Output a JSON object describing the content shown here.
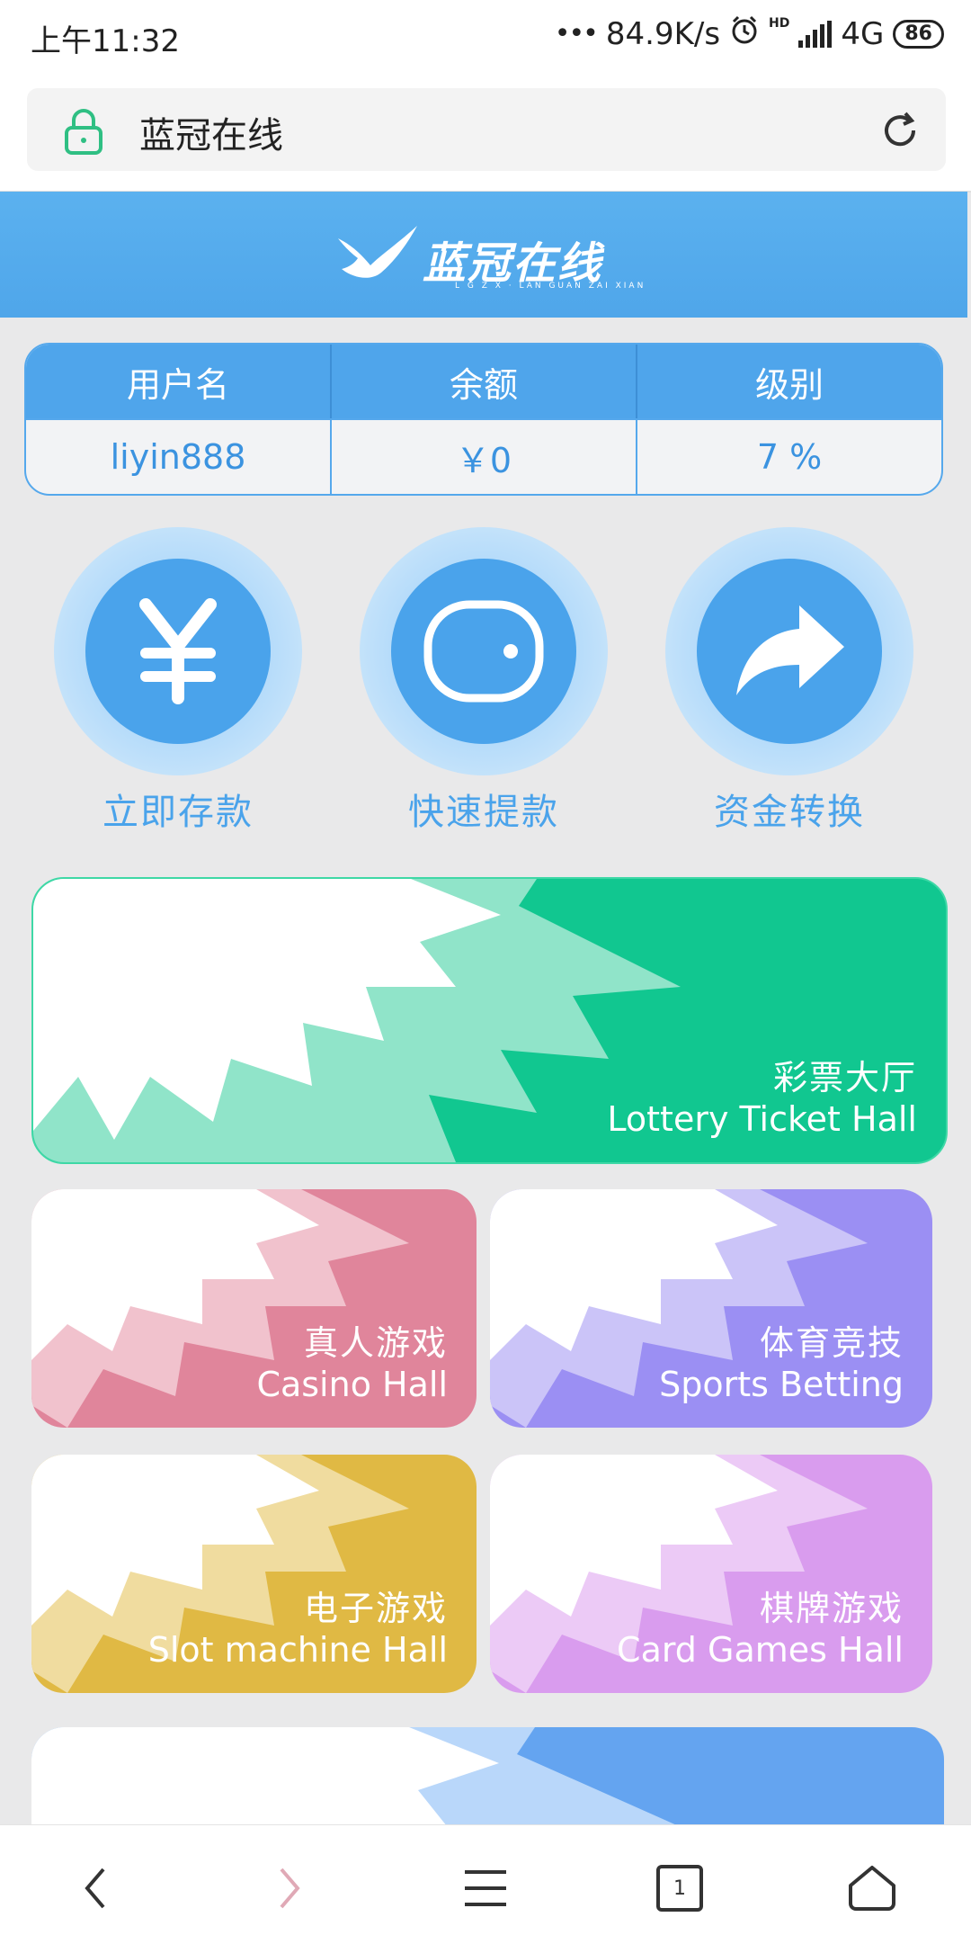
{
  "status_bar": {
    "time": "上午11:32",
    "network_speed": "84.9K/s",
    "network_type": "4G",
    "hd_badge": "HD",
    "battery": "86"
  },
  "browser": {
    "page_title": "蓝冠在线"
  },
  "site": {
    "logo_text": "蓝冠在线",
    "logo_subtitle": "L G Z X · LAN GUAN ZAI XIAN"
  },
  "user_table": {
    "headers": [
      "用户名",
      "余额",
      "级别"
    ],
    "values": [
      "liyin888",
      "￥0",
      "7 %"
    ]
  },
  "actions": [
    {
      "label": "立即存款",
      "icon": "yen-icon"
    },
    {
      "label": "快速提款",
      "icon": "wallet-icon"
    },
    {
      "label": "资金转换",
      "icon": "share-arrow-icon"
    }
  ],
  "halls": [
    {
      "cn": "彩票大厅",
      "en": "Lottery Ticket Hall",
      "color": "#11c790"
    },
    {
      "cn": "真人游戏",
      "en": "Casino Hall",
      "color": "#e0859b"
    },
    {
      "cn": "体育竞技",
      "en": "Sports Betting",
      "color": "#9b8ff3"
    },
    {
      "cn": "电子游戏",
      "en": "Slot machine Hall",
      "color": "#e0b944"
    },
    {
      "cn": "棋牌游戏",
      "en": "Card Games Hall",
      "color": "#d99cee"
    },
    {
      "cn": "",
      "en": "",
      "color": "#64a4f0"
    }
  ],
  "bottom_nav": {
    "tab_count": "1"
  },
  "colors": {
    "brand_blue": "#4fa6ea",
    "background": "#e9e9ea"
  }
}
